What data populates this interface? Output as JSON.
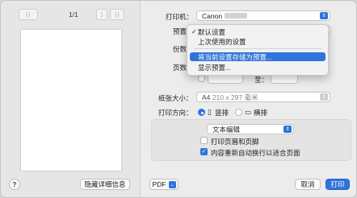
{
  "preview": {
    "prev_first_glyph": "⟨⟨",
    "prev_glyph": "⟨",
    "page_indicator": "1/1",
    "next_glyph": "⟩",
    "next_last_glyph": "⟩⟩",
    "help_label": "?",
    "hide_details_label": "隐藏详细信息"
  },
  "printer": {
    "label": "打印机：",
    "value": "Canon"
  },
  "presets": {
    "label": "预置：",
    "menu_items": [
      {
        "label": "默认设置",
        "checked": true
      },
      {
        "label": "上次使用的设置",
        "checked": false
      },
      {
        "label": "将当前设置存储为预置...",
        "highlighted": true
      },
      {
        "label": "显示预置..."
      }
    ]
  },
  "copies": {
    "label": "份数："
  },
  "pages": {
    "label": "页数：",
    "to_fragment": "至："
  },
  "paper_size": {
    "label": "纸张大小：",
    "value": "A4",
    "dims": "210 x 297 毫米"
  },
  "orientation": {
    "label": "打印方向：",
    "portrait": "竖排",
    "landscape": "横排",
    "selected": "portrait"
  },
  "app_section": {
    "dropdown_value": "文本编辑",
    "header_footer_label": "打印页眉和页脚",
    "header_footer_checked": false,
    "rewrap_label": "内容重新自动换行以适合页面",
    "rewrap_checked": true
  },
  "footer": {
    "pdf_label": "PDF",
    "cancel_label": "取消",
    "print_label": "打印"
  },
  "colors": {
    "accent": "#2f74dc",
    "dialog_bg": "#ececec"
  }
}
